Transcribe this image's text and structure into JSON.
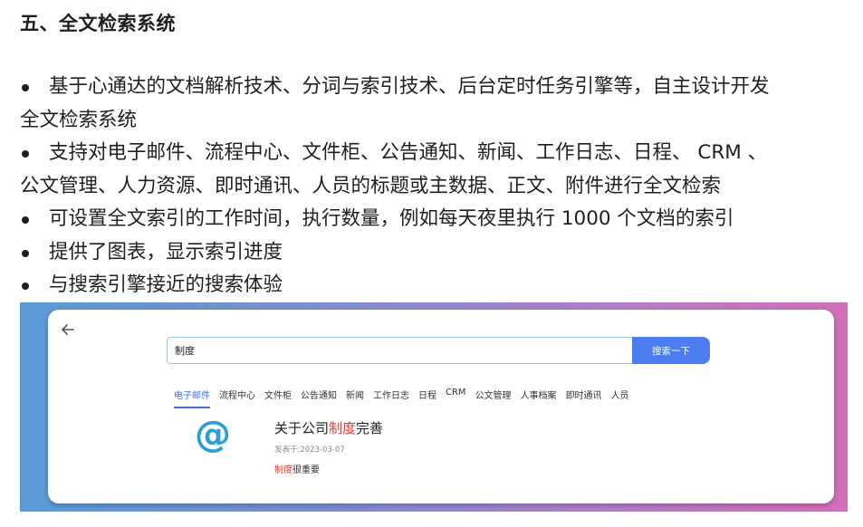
{
  "heading": "五、全文检索系统",
  "bullets": [
    {
      "line1": "基于心通达的文档解析技术、分词与索引技术、后台定时任务引擎等，自主设计开发",
      "line2": "全文检索系统"
    },
    {
      "line1": "支持对电子邮件、流程中心、文件柜、公告通知、新闻、工作日志、日程、 CRM 、",
      "line2": "公文管理、人力资源、即时通讯、人员的标题或主数据、正文、附件进行全文检索"
    },
    {
      "line1": "可设置全文索引的工作时间，执行数量，例如每天夜里执行 1000 个文档的索引"
    },
    {
      "line1": "提供了图表，显示索引进度"
    },
    {
      "line1": "与搜索引擎接近的搜索体验"
    }
  ],
  "screenshot": {
    "search": {
      "value": "制度",
      "button": "搜索一下"
    },
    "tabs": [
      "电子邮件",
      "流程中心",
      "文件柜",
      "公告通知",
      "新闻",
      "工作日志",
      "日程",
      "CRM",
      "公文管理",
      "人事档案",
      "即时通讯",
      "人员"
    ],
    "active_tab": "电子邮件",
    "result": {
      "icon": "at-icon",
      "title_prefix": "关于公司",
      "title_highlight": "制度",
      "title_suffix": "完善",
      "date": "发表于:2023-03-07",
      "snippet_highlight": "制度",
      "snippet_suffix": "很重要"
    },
    "colors": {
      "accent": "#4d7cf0",
      "highlight": "#e53935",
      "icon": "#2a9fd6"
    }
  }
}
